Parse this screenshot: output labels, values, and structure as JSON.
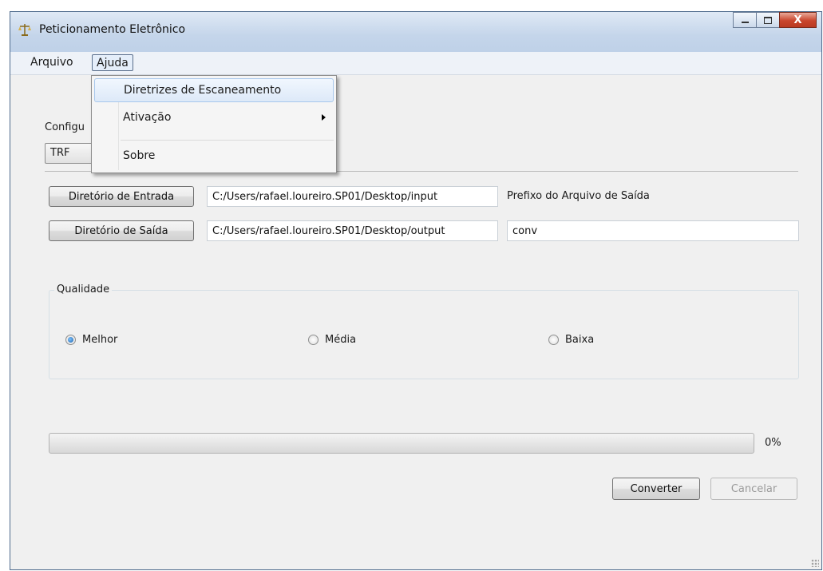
{
  "window": {
    "title": "Peticionamento Eletrônico",
    "controls": {
      "minimize": "minimize-icon",
      "maximize": "maximize-icon",
      "close_label": "X"
    }
  },
  "menubar": {
    "items": [
      {
        "label": "Arquivo"
      },
      {
        "label": "Ajuda"
      }
    ]
  },
  "dropdown": {
    "items": [
      {
        "label": "Diretrizes de Escaneamento"
      },
      {
        "label": "Ativação"
      },
      {
        "label": "Sobre"
      }
    ]
  },
  "config": {
    "label": "Configu",
    "selected": "TRF"
  },
  "dirs": {
    "input_button": "Diretório de Entrada",
    "input_path": "C:/Users/rafael.loureiro.SP01/Desktop/input",
    "output_button": "Diretório de Saída",
    "output_path": "C:/Users/rafael.loureiro.SP01/Desktop/output",
    "prefix_label": "Prefixo do Arquivo de Saída",
    "prefix_value": "conv"
  },
  "quality": {
    "legend": "Qualidade",
    "options": [
      {
        "label": "Melhor",
        "checked": true
      },
      {
        "label": "Média",
        "checked": false
      },
      {
        "label": "Baixa",
        "checked": false
      }
    ]
  },
  "progress": {
    "value": 0,
    "label": "0%"
  },
  "actions": {
    "convert": "Converter",
    "cancel": "Cancelar"
  },
  "colors": {
    "titlebar": "#c4d5ea",
    "close_button": "#c9452c",
    "menu_highlight": "#dde9f8"
  }
}
